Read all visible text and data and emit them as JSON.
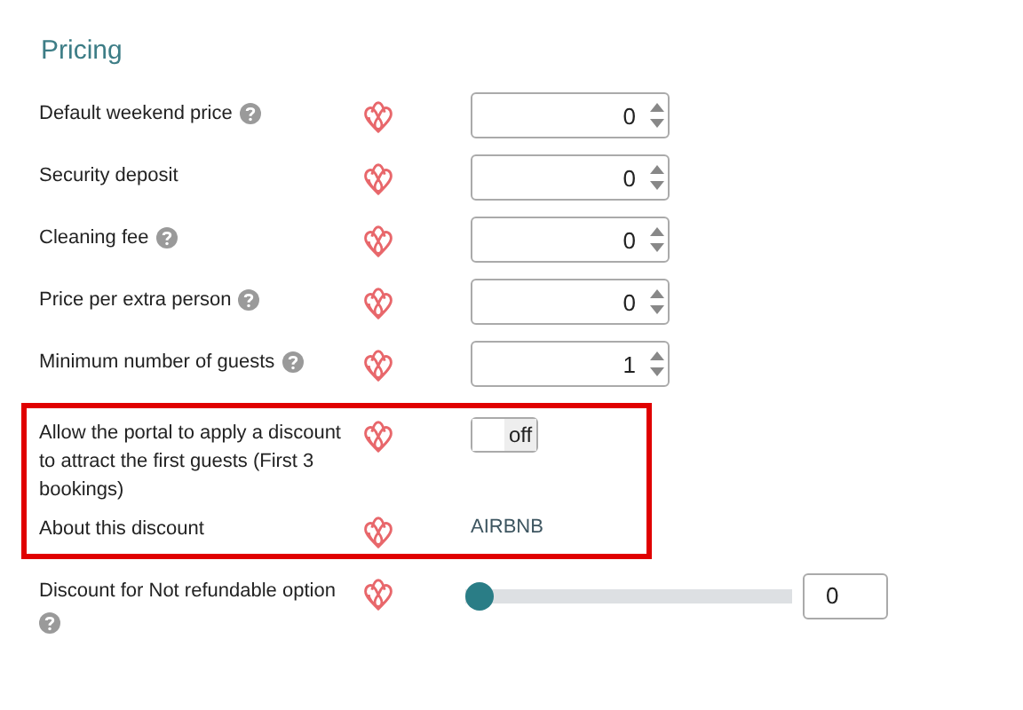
{
  "section": {
    "title": "Pricing"
  },
  "rows": [
    {
      "kind": "number",
      "label": "Default weekend price",
      "help": true,
      "value": "0",
      "highlighted": false
    },
    {
      "kind": "number",
      "label": "Security deposit",
      "help": false,
      "value": "0",
      "highlighted": false
    },
    {
      "kind": "number",
      "label": "Cleaning fee",
      "help": true,
      "value": "0",
      "highlighted": false
    },
    {
      "kind": "number",
      "label": "Price per extra person",
      "help": true,
      "value": "0",
      "highlighted": false
    },
    {
      "kind": "number",
      "label": "Minimum number of guests",
      "help": true,
      "value": "1",
      "highlighted": false
    },
    {
      "kind": "toggle",
      "label": "Allow the portal to apply a discount to attract the first guests (First 3 bookings)",
      "help": false,
      "on": false,
      "state_label": "off",
      "highlighted": true
    },
    {
      "kind": "text",
      "label": "About this discount",
      "help": false,
      "value": "AIRBNB",
      "highlighted": true
    },
    {
      "kind": "slider",
      "label": "Discount for Not refundable option",
      "help": true,
      "level": 0,
      "value": "0",
      "highlighted": false
    }
  ]
}
